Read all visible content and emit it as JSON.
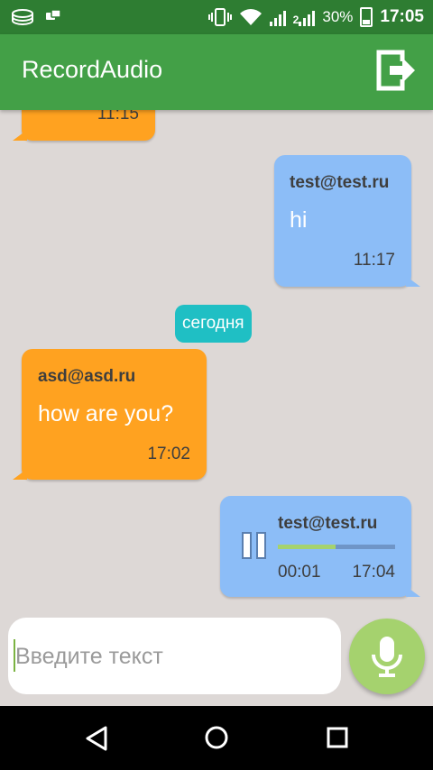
{
  "status_bar": {
    "battery_percent": "30%",
    "time": "17:05",
    "sim2_label": "2"
  },
  "app_bar": {
    "title": "RecordAudio",
    "action_icon": "exit-icon"
  },
  "messages": [
    {
      "type": "text",
      "direction": "incoming",
      "sender": "",
      "text": "",
      "time": "11:15"
    },
    {
      "type": "text",
      "direction": "outgoing",
      "sender": "test@test.ru",
      "text": "hi",
      "time": "11:17"
    },
    {
      "type": "date",
      "label": "сегодня"
    },
    {
      "type": "text",
      "direction": "incoming",
      "sender": "asd@asd.ru",
      "text": "how are you?",
      "time": "17:02"
    },
    {
      "type": "audio",
      "direction": "outgoing",
      "sender": "test@test.ru",
      "elapsed": "00:01",
      "time": "17:04",
      "progress": 0.49,
      "state": "playing"
    }
  ],
  "composer": {
    "placeholder": "Введите текст",
    "mic_icon": "mic-icon"
  },
  "colors": {
    "status_bar": "#2e7d32",
    "app_bar": "#43a047",
    "incoming_bubble": "#ffa220",
    "outgoing_bubble": "#8cbdf7",
    "date_chip": "#1fbfc4",
    "accent": "#a5d26e",
    "background": "#ddd8d6"
  }
}
